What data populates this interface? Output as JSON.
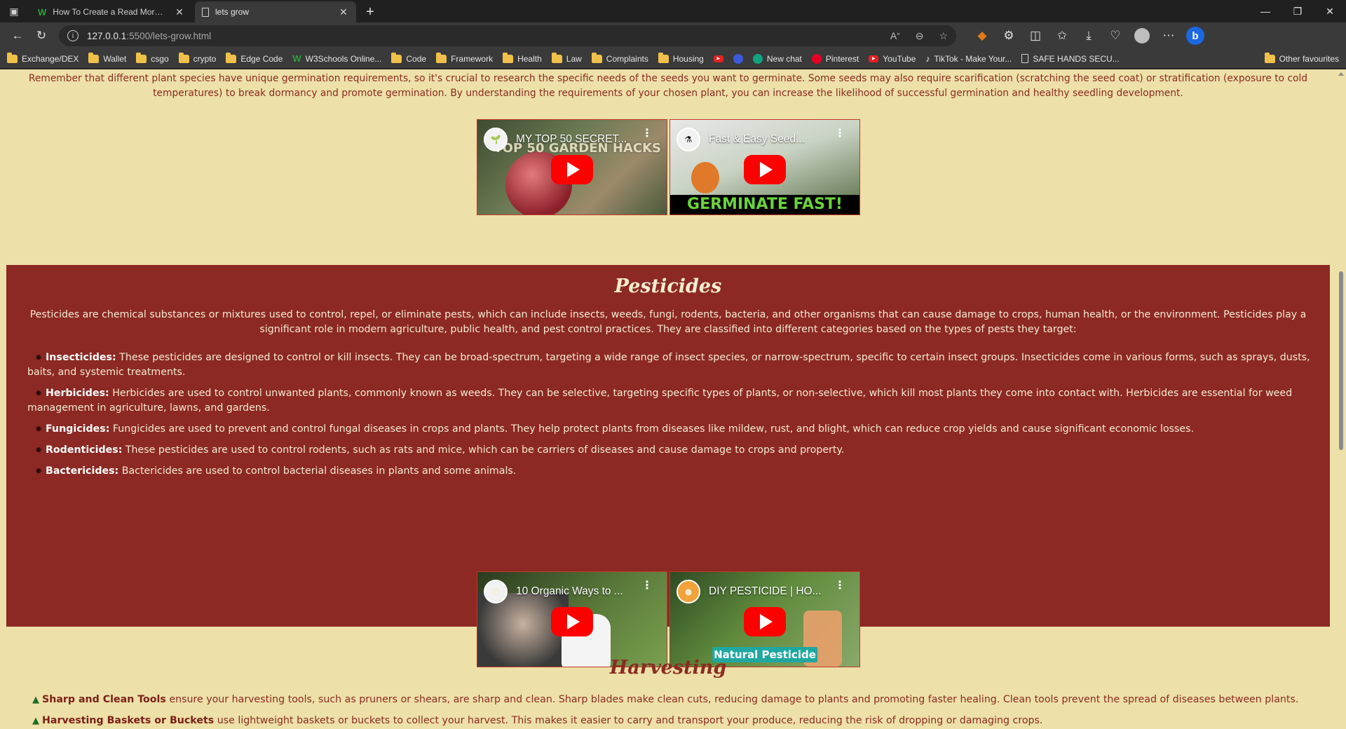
{
  "tabs": [
    {
      "title": "How To Create a Read More Rea",
      "active": false
    },
    {
      "title": "lets grow",
      "active": true
    }
  ],
  "address": {
    "host": "127.0.0.1",
    "rest": ":5500/lets-grow.html"
  },
  "bookmarks": [
    {
      "label": "Exchange/DEX",
      "icon": "folder"
    },
    {
      "label": "Wallet",
      "icon": "folder"
    },
    {
      "label": "csgo",
      "icon": "folder"
    },
    {
      "label": "crypto",
      "icon": "folder"
    },
    {
      "label": "Edge Code",
      "icon": "folder"
    },
    {
      "label": "W3Schools Online...",
      "icon": "w3schools"
    },
    {
      "label": "Code",
      "icon": "folder"
    },
    {
      "label": "Framework",
      "icon": "folder"
    },
    {
      "label": "Health",
      "icon": "folder"
    },
    {
      "label": "Law",
      "icon": "folder"
    },
    {
      "label": "Complaints",
      "icon": "folder"
    },
    {
      "label": "Housing",
      "icon": "folder"
    },
    {
      "label": "",
      "icon": "youtube"
    },
    {
      "label": "",
      "icon": "blue-circle"
    },
    {
      "label": "New chat",
      "icon": "chatgpt"
    },
    {
      "label": "Pinterest",
      "icon": "pinterest"
    },
    {
      "label": "YouTube",
      "icon": "youtube"
    },
    {
      "label": "TikTok - Make Your...",
      "icon": "tiktok"
    },
    {
      "label": "SAFE HANDS SECU...",
      "icon": "page"
    }
  ],
  "bookmarks_other": "Other favourites",
  "page": {
    "intro_text": "Remember that different plant species have unique germination requirements, so it's crucial to research the specific needs of the seeds you want to germinate. Some seeds may also require scarification (scratching the seed coat) or stratification (exposure to cold temperatures) to break dormancy and promote germination. By understanding the requirements of your chosen plant, you can increase the likelihood of successful germination and healthy seedling development.",
    "germination_videos": [
      {
        "title": "MY TOP 50 SECRET...",
        "overlay": "TOP 50 GARDEN HACKS"
      },
      {
        "title": "Fast & Easy Seed...",
        "overlay": "GERMINATE FAST!"
      }
    ],
    "pesticides": {
      "title": "Pesticides",
      "lead": "Pesticides are chemical substances or mixtures used to control, repel, or eliminate pests, which can include insects, weeds, fungi, rodents, bacteria, and other organisms that can cause damage to crops, human health, or the environment. Pesticides play a significant role in modern agriculture, public health, and pest control practices. They are classified into different categories based on the types of pests they target:",
      "items": [
        {
          "term": "Insecticides:",
          "text": " These pesticides are designed to control or kill insects. They can be broad-spectrum, targeting a wide range of insect species, or narrow-spectrum, specific to certain insect groups. Insecticides come in various forms, such as sprays, dusts, baits, and systemic treatments."
        },
        {
          "term": "Herbicides:",
          "text": " Herbicides are used to control unwanted plants, commonly known as weeds. They can be selective, targeting specific types of plants, or non-selective, which kill most plants they come into contact with. Herbicides are essential for weed management in agriculture, lawns, and gardens."
        },
        {
          "term": "Fungicides:",
          "text": " Fungicides are used to prevent and control fungal diseases in crops and plants. They help protect plants from diseases like mildew, rust, and blight, which can reduce crop yields and cause significant economic losses."
        },
        {
          "term": "Rodenticides:",
          "text": " These pesticides are used to control rodents, such as rats and mice, which can be carriers of diseases and cause damage to crops and property."
        },
        {
          "term": "Bactericides:",
          "text": " Bactericides are used to control bacterial diseases in plants and some animals."
        }
      ],
      "videos": [
        {
          "title": "10 Organic Ways to ...",
          "overlay": ""
        },
        {
          "title": "DIY PESTICIDE | HO...",
          "overlay": "Natural Pesticide"
        }
      ]
    },
    "harvesting": {
      "title": "Harvesting",
      "items": [
        {
          "term": "Sharp and Clean Tools",
          "text": " ensure your harvesting tools, such as pruners or shears, are sharp and clean. Sharp blades make clean cuts, reducing damage to plants and promoting faster healing. Clean tools prevent the spread of diseases between plants."
        },
        {
          "term": "Harvesting Baskets or Buckets",
          "text": " use lightweight baskets or buckets to collect your harvest. This makes it easier to carry and transport your produce, reducing the risk of dropping or damaging crops."
        }
      ]
    }
  }
}
